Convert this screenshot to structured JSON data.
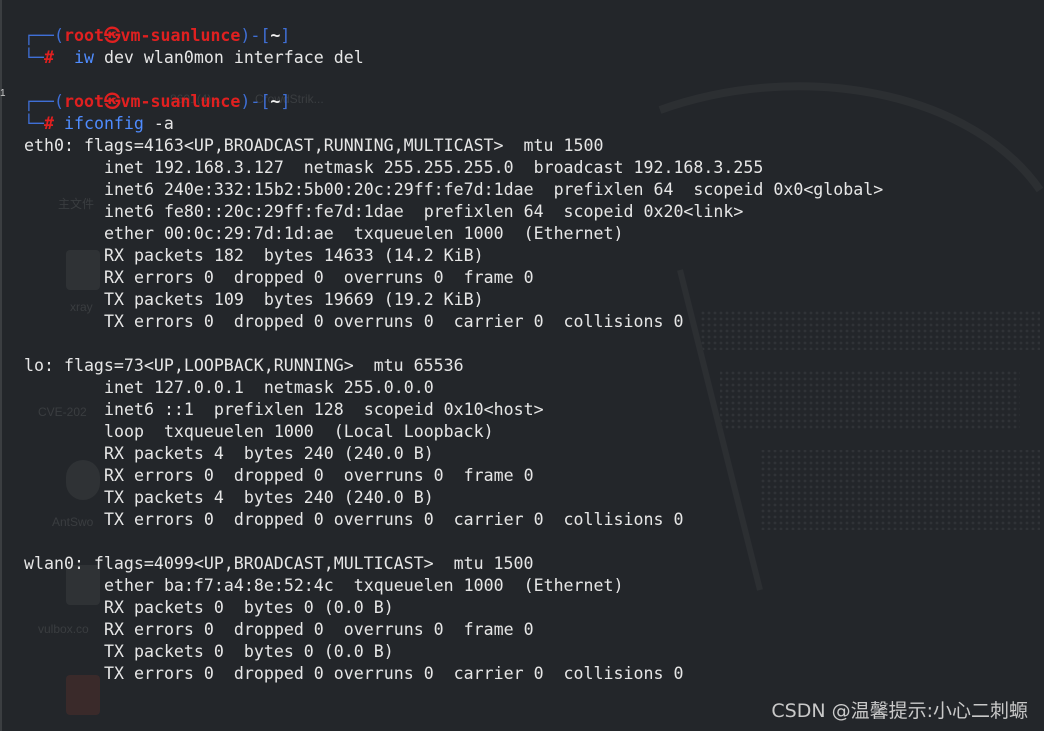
{
  "prompts": [
    {
      "user": "root",
      "skull": "㉿",
      "host": "vm-suanlunce",
      "dir": "~",
      "command": "iw",
      "args": "dev wlan0mon interface del"
    },
    {
      "user": "root",
      "skull": "㉿",
      "host": "vm-suanlunce",
      "dir": "~",
      "command": "ifconfig",
      "args": "-a"
    }
  ],
  "interfaces": [
    {
      "header": "eth0: flags=4163<UP,BROADCAST,RUNNING,MULTICAST>  mtu 1500",
      "lines": [
        "inet 192.168.3.127  netmask 255.255.255.0  broadcast 192.168.3.255",
        "inet6 240e:332:15b2:5b00:20c:29ff:fe7d:1dae  prefixlen 64  scopeid 0x0<global>",
        "inet6 fe80::20c:29ff:fe7d:1dae  prefixlen 64  scopeid 0x20<link>",
        "ether 00:0c:29:7d:1d:ae  txqueuelen 1000  (Ethernet)",
        "RX packets 182  bytes 14633 (14.2 KiB)",
        "RX errors 0  dropped 0  overruns 0  frame 0",
        "TX packets 109  bytes 19669 (19.2 KiB)",
        "TX errors 0  dropped 0 overruns 0  carrier 0  collisions 0"
      ]
    },
    {
      "header": "lo: flags=73<UP,LOOPBACK,RUNNING>  mtu 65536",
      "lines": [
        "inet 127.0.0.1  netmask 255.0.0.0",
        "inet6 ::1  prefixlen 128  scopeid 0x10<host>",
        "loop  txqueuelen 1000  (Local Loopback)",
        "RX packets 4  bytes 240 (240.0 B)",
        "RX errors 0  dropped 0  overruns 0  frame 0",
        "TX packets 4  bytes 240 (240.0 B)",
        "TX errors 0  dropped 0 overruns 0  carrier 0  collisions 0"
      ]
    },
    {
      "header": "wlan0: flags=4099<UP,BROADCAST,MULTICAST>  mtu 1500",
      "lines": [
        "ether ba:f7:a4:8e:52:4c  txqueuelen 1000  (Ethernet)",
        "RX packets 0  bytes 0 (0.0 B)",
        "RX errors 0  dropped 0  overruns 0  frame 0",
        "TX packets 0  bytes 0 (0.0 B)",
        "TX errors 0  dropped 0 overruns 0  carrier 0  collisions 0"
      ]
    }
  ],
  "watermark": "CSDN @温馨提示:小心二刺螈",
  "side_marker": "1",
  "background_labels": [
    "主文件",
    "xray",
    "CVE-202",
    "AntSwo",
    "vulbox.co",
    "8601(4)...",
    "CrowdStrik..."
  ],
  "colors": {
    "background": "#23262a",
    "prompt_frame": "#3f6fd6",
    "prompt_user": "#e02020",
    "command": "#4f8cff",
    "text": "#e6e6e6"
  }
}
